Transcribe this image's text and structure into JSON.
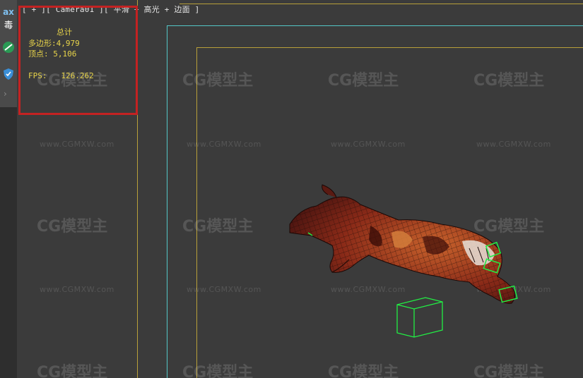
{
  "side_panel": {
    "max_label": "ax",
    "cn_label": "毒"
  },
  "viewport": {
    "label": "[ + ][ Camera01 ][ 平滑 + 高光 + 边面 ]"
  },
  "stats": {
    "heading": "总计",
    "polygons": "多边形:4,979",
    "vertices": "顶点: 5,106",
    "fps": "FPS:   126.262"
  },
  "watermark": {
    "logo": "CG模型主",
    "url": "www.CGMXW.com"
  },
  "colors": {
    "viewport_bg": "#3b3b3b",
    "safe_frame_yellow": "#b8a03a",
    "safe_frame_cyan": "#53c7c7",
    "stats_text": "#e8d44a",
    "selection_highlight": "#c42222",
    "bone_green": "#22ee44"
  }
}
